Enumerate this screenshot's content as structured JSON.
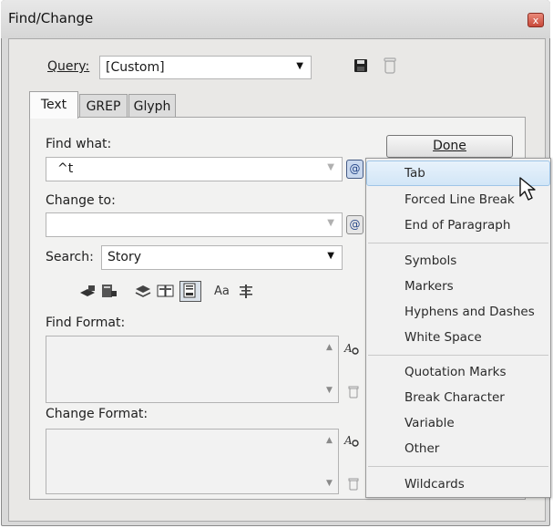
{
  "window": {
    "title": "Find/Change",
    "close_glyph": "x"
  },
  "query": {
    "label": "Query:",
    "value": "[Custom]"
  },
  "tabs": [
    {
      "label": "Text"
    },
    {
      "label": "GREP"
    },
    {
      "label": "Glyph"
    }
  ],
  "find": {
    "label": "Find what:",
    "value": "^t"
  },
  "change": {
    "label": "Change to:",
    "value": ""
  },
  "done_label": "Done",
  "search": {
    "label": "Search:",
    "value": "Story",
    "case_label": "Aa"
  },
  "find_format": {
    "label": "Find Format:"
  },
  "change_format": {
    "label": "Change Format:"
  },
  "special_icon": "@",
  "menu": {
    "items": [
      "Tab",
      "Forced Line Break",
      "End of Paragraph",
      "Symbols",
      "Markers",
      "Hyphens and Dashes",
      "White Space",
      "Quotation Marks",
      "Break Character",
      "Variable",
      "Other",
      "Wildcards"
    ],
    "highlighted": "Tab"
  },
  "colors": {
    "menu_highlight": "#d2e6f7",
    "panel": "#f2f2f1",
    "close": "#c8493a"
  }
}
